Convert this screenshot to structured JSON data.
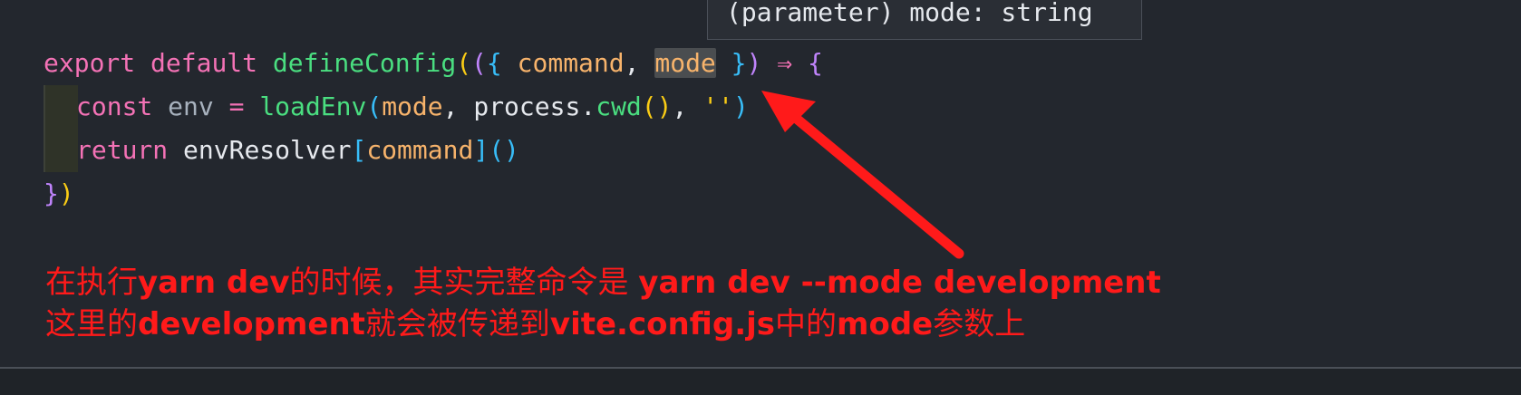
{
  "tooltip": {
    "text": "(parameter) mode: string"
  },
  "code": {
    "line1": {
      "kw_export": "export",
      "kw_default": "default",
      "fn_defineConfig": "defineConfig",
      "open_paren": "(",
      "open_paren2": "(",
      "open_brace": "{",
      "param_command": "command",
      "comma": ",",
      "param_mode": "mode",
      "close_brace": "}",
      "close_paren": ")",
      "arrow": "⇒",
      "body_brace": "{"
    },
    "line2": {
      "kw_const": "const",
      "var_env": "env",
      "equals": "=",
      "fn_loadEnv": "loadEnv",
      "open_paren": "(",
      "arg_mode": "mode",
      "comma1": ",",
      "obj_process": "process",
      "dot": ".",
      "fn_cwd": "cwd",
      "call_parens": "()",
      "comma2": ",",
      "string_quote": "''",
      "close_paren": ")"
    },
    "line3": {
      "kw_return": "return",
      "obj_envResolver": "envResolver",
      "open_bracket": "[",
      "param_command": "command",
      "close_bracket": "]",
      "call_parens": "()"
    },
    "line4": {
      "close_brace": "}",
      "close_paren": ")"
    }
  },
  "annotation": {
    "line1": {
      "t1": "在执行",
      "b1": "yarn dev",
      "t2": "的时候，其实完整命令是 ",
      "b2": "yarn dev --mode development"
    },
    "line2": {
      "t1": "这里的",
      "b1": "development",
      "t2": "就会被传递到",
      "b2": "vite.config.js",
      "t3": "中的",
      "b3": "mode",
      "t4": "参数上"
    }
  },
  "colors": {
    "background": "#23272e",
    "keyword": "#f472b6",
    "function": "#4ade80",
    "parameter": "#f7b36b",
    "annotation": "#ff1a1a",
    "arrow": "#ff1a1a"
  }
}
